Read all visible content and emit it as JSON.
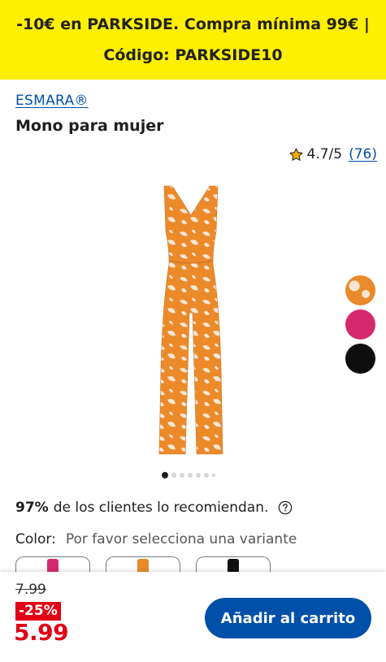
{
  "promo": {
    "line1": "-10€ en PARKSIDE. Compra mínima 99€ |",
    "line2": "Código: PARKSIDE10"
  },
  "product": {
    "brand": "ESMARA®",
    "title": "Mono para mujer",
    "rating": "4.7/5",
    "review_count": "(76)"
  },
  "gallery": {
    "swatches": [
      "orange-floral",
      "pink",
      "black"
    ],
    "active_image": 1,
    "image_count": 7
  },
  "recommend": {
    "percent": "97%",
    "text": "de los clientes lo recomiendan."
  },
  "color": {
    "label": "Color:",
    "hint": "Por favor selecciona una variante"
  },
  "price": {
    "old": "7.99",
    "discount": "-25%",
    "current": "5.99"
  },
  "cart": {
    "button_label": "Añadir al carrito"
  },
  "colors": {
    "banner": "#ffef00",
    "accent": "#0050aa",
    "sale": "#e10015"
  }
}
